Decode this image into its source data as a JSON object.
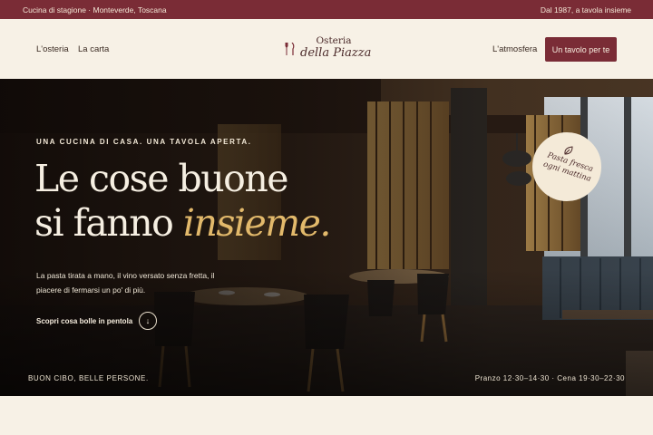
{
  "topbar": {
    "left_text": "Cucina di stagione · Monteverde, Toscana",
    "right_text": "Dal 1987, a tavola insieme"
  },
  "nav": {
    "left_items": [
      {
        "label": "L'osteria"
      },
      {
        "label": "La carta"
      }
    ],
    "right_items": [
      {
        "label": "L'atmosfera"
      }
    ],
    "cta_label": "Un tavolo per te"
  },
  "logo": {
    "line1": "Osteria",
    "line2": "della Piazza",
    "icon": "fork-knife-icon"
  },
  "hero": {
    "eyebrow": "UNA CUCINA DI CASA. UNA TAVOLA APERTA.",
    "headline_line1": "Le cose buone",
    "headline_line2_start": "si fanno ",
    "headline_accent": "insieme",
    "headline_end": ".",
    "subtext": "La pasta tirata a mano, il vino versato senza fretta, il piacere di fermarsi un po' di più.",
    "discover_label": "Scopri cosa bolle in pentola",
    "discover_icon": "arrow-down-icon",
    "footer_left": "BUON CIBO, BELLE PERSONE.",
    "footer_right": "Pranzo 12·30–14·30 · Cena 19·30–22·30",
    "badge_text": "Pasta fresca ogni mattina",
    "badge_icon": "leaf-icon"
  },
  "colors": {
    "brand": "#7a2c36",
    "cream": "#f7f1e6",
    "accent_gold": "#e2b96b"
  }
}
